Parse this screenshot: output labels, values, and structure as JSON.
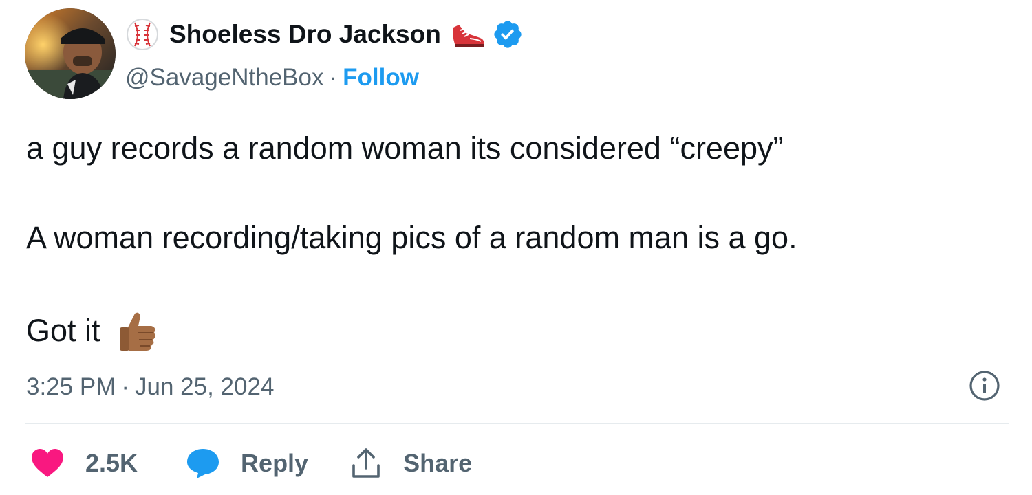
{
  "author": {
    "display_name": "Shoeless Dro Jackson",
    "handle": "@SavageNtheBox",
    "separator": "·",
    "follow_label": "Follow",
    "name_emoji_left": "baseball-icon",
    "name_emoji_right": "running-shoe-icon",
    "verified": true
  },
  "tweet": {
    "lines": [
      "a guy records a random woman its considered “creepy”",
      "A woman recording/taking pics of a random man is a go.",
      "Got it"
    ],
    "trailing_emoji": "thumbs-up-icon",
    "time": "3:25 PM",
    "date_separator": "·",
    "date": "Jun 25, 2024"
  },
  "actions": {
    "like_count": "2.5K",
    "reply_label": "Reply",
    "share_label": "Share"
  },
  "colors": {
    "accent": "#1d9bf0",
    "like": "#f91880",
    "text": "#0f1419",
    "muted": "#536471",
    "divider": "#e6ebee"
  }
}
